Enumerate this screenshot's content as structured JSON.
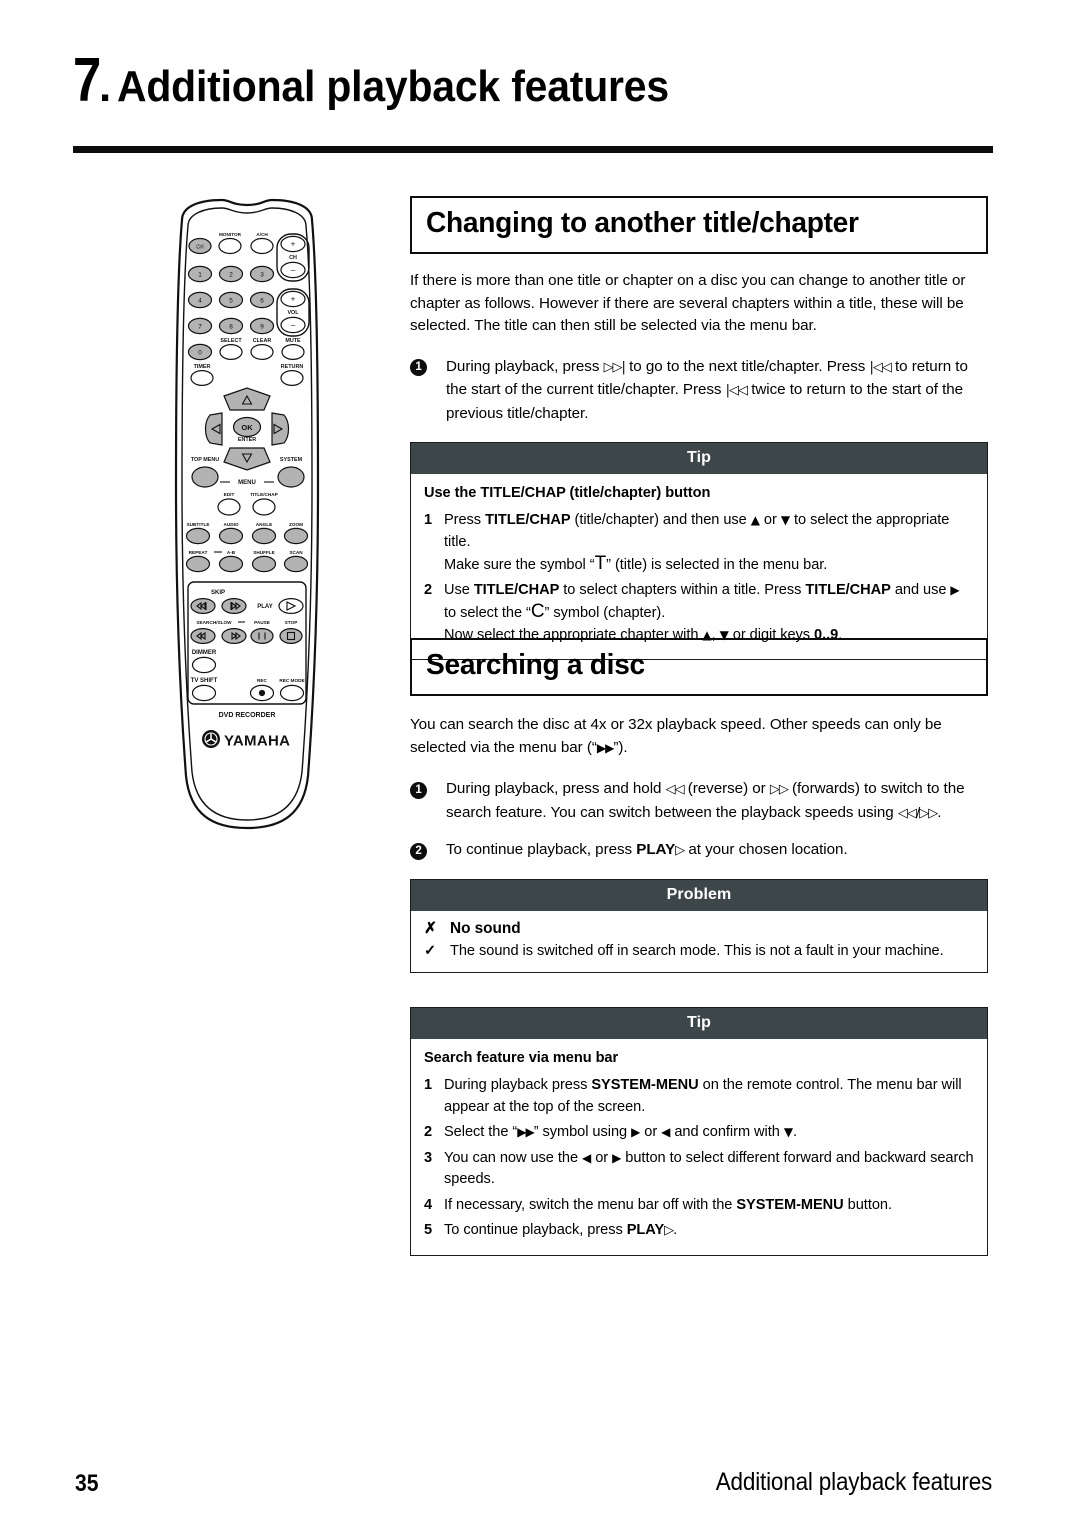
{
  "chapter": {
    "number": "7",
    "dot": ".",
    "name": "Additional playback features"
  },
  "remote": {
    "brand": "YAMAHA",
    "bottom_panel_label": "DVD RECORDER",
    "labels": {
      "power": "⏻/I",
      "monitor": "MONITOR",
      "ach": "A/CH",
      "ch": "CH",
      "vol": "VOL",
      "plus": "+",
      "minus": "–",
      "d1": "1",
      "d2": "2",
      "d3": "3",
      "d4": "4",
      "d5": "5",
      "d6": "6",
      "d7": "7",
      "d8": "8",
      "d9": "9",
      "d0": "0",
      "select": "SELECT",
      "clear": "CLEAR",
      "mute": "MUTE",
      "timer": "TIMER",
      "return": "RETURN",
      "ok": "OK",
      "enter": "ENTER",
      "top_menu": "TOP MENU",
      "system": "SYSTEM",
      "menu": "MENU",
      "edit": "EDIT",
      "title_chap": "TITLE/CHAP",
      "subtitle": "SUBTITLE",
      "audio": "AUDIO",
      "angle": "ANGLE",
      "zoom": "ZOOM",
      "repeat": "REPEAT",
      "ab": "A-B",
      "shuffle": "SHUFFLE",
      "scan": "SCAN",
      "skip": "SKIP",
      "play": "PLAY",
      "search_slow": "SEARCH/SLOW",
      "pause": "PAUSE",
      "stop": "STOP",
      "dimmer": "DIMMER",
      "tv_shift": "TV SHIFT",
      "rec": "REC",
      "rec_mode": "REC MODE"
    }
  },
  "section1": {
    "heading": "Changing to another title/chapter",
    "intro": "If there is more than one title or chapter on a disc you can change to another title or chapter as follows. However if there are several chapters within a title, these will be selected. The title can then still be selected via the menu bar.",
    "steps": [
      {
        "num": "1",
        "t1": "During playback, press ",
        "g1": "▷▷|",
        "t2": " to go to the next title/chapter. Press ",
        "g2": "|◁◁",
        "t3": " to return to the start of the current title/chapter. Press ",
        "g3": "|◁◁",
        "t4": " twice to return to the start of the previous title/chapter."
      }
    ],
    "tip": {
      "header": "Tip",
      "subtitle": "Use the TITLE/CHAP (title/chapter) button",
      "item1_num": "1",
      "item1_a": "Press ",
      "item1_b": "TITLE/CHAP",
      "item1_c": " (title/chapter) and then use ",
      "item1_up": "▲",
      "item1_d": " or ",
      "item1_down": "▼",
      "item1_e": " to select the appropriate title.",
      "item1_f1": "Make sure the symbol “",
      "item1_sym": "T",
      "item1_f2": "” (title) is selected in the menu bar.",
      "item2_num": "2",
      "item2_a": "Use ",
      "item2_b": "TITLE/CHAP",
      "item2_c": " to select chapters within a title. Press ",
      "item2_d": "TITLE/CHAP",
      "item2_e": " and use ",
      "item2_right": "▶",
      "item2_f1": " to select the “",
      "item2_sym": "C",
      "item2_f2": "” symbol (chapter).",
      "item2_g1": "Now select the appropriate chapter with ",
      "item2_up": "▲",
      "item2_g2": ", ",
      "item2_down": "▼",
      "item2_g3": " or digit keys ",
      "item2_digits": "0..9",
      "item2_g4": "."
    }
  },
  "section2": {
    "heading": "Searching a disc",
    "intro_a": "You can search the disc at 4x or 32x playback speed. Other speeds can only be selected via the menu bar (“",
    "intro_sym": "▶▶",
    "intro_b": "”).",
    "steps": [
      {
        "num": "1",
        "t1": "During playback, press and hold ",
        "g1": "◁◁",
        "t2": " (reverse) or ",
        "g2": "▷▷",
        "t3": " (forwards) to switch to the search feature. You can switch between the playback speeds using ",
        "g3": "◁◁/▷▷",
        "t4": "."
      },
      {
        "num": "2",
        "t1": "To continue playback, press ",
        "b1": "PLAY",
        "g1": "▷",
        "t2": " at your chosen location."
      }
    ],
    "problem": {
      "header": "Problem",
      "x_symbol": "✗",
      "title": "No sound",
      "check_symbol": "✓",
      "line": "The sound is switched off in search mode. This is not a fault in your machine."
    },
    "tip": {
      "header": "Tip",
      "subtitle": "Search feature via menu bar",
      "items": [
        {
          "num": "1",
          "a": "During playback press ",
          "b": "SYSTEM-MENU",
          "c": " on the remote control. The menu bar will appear at the top of the screen."
        },
        {
          "num": "2",
          "a": "Select the “",
          "sym": "▶▶",
          "b": "” symbol using ",
          "right": "▶",
          "c": " or ",
          "left": "◀",
          "d": " and confirm with ",
          "down": "▼",
          "e": "."
        },
        {
          "num": "3",
          "a": "You can now use the ",
          "left": "◀",
          "b": " or ",
          "right": "▶",
          "c": " button to select different forward and backward search speeds."
        },
        {
          "num": "4",
          "a": "If necessary, switch the menu bar off with the ",
          "b": "SYSTEM-MENU",
          "c": " button."
        },
        {
          "num": "5",
          "a": "To continue playback, press ",
          "b": "PLAY",
          "sym": "▷",
          "c": "."
        }
      ]
    }
  },
  "footer": {
    "page_number": "35",
    "section_name": "Additional playback features"
  },
  "colors": {
    "callout_header_bg": "#3d4649",
    "rule": "#0d0d0d",
    "button_fill": "#b3b3b3"
  }
}
